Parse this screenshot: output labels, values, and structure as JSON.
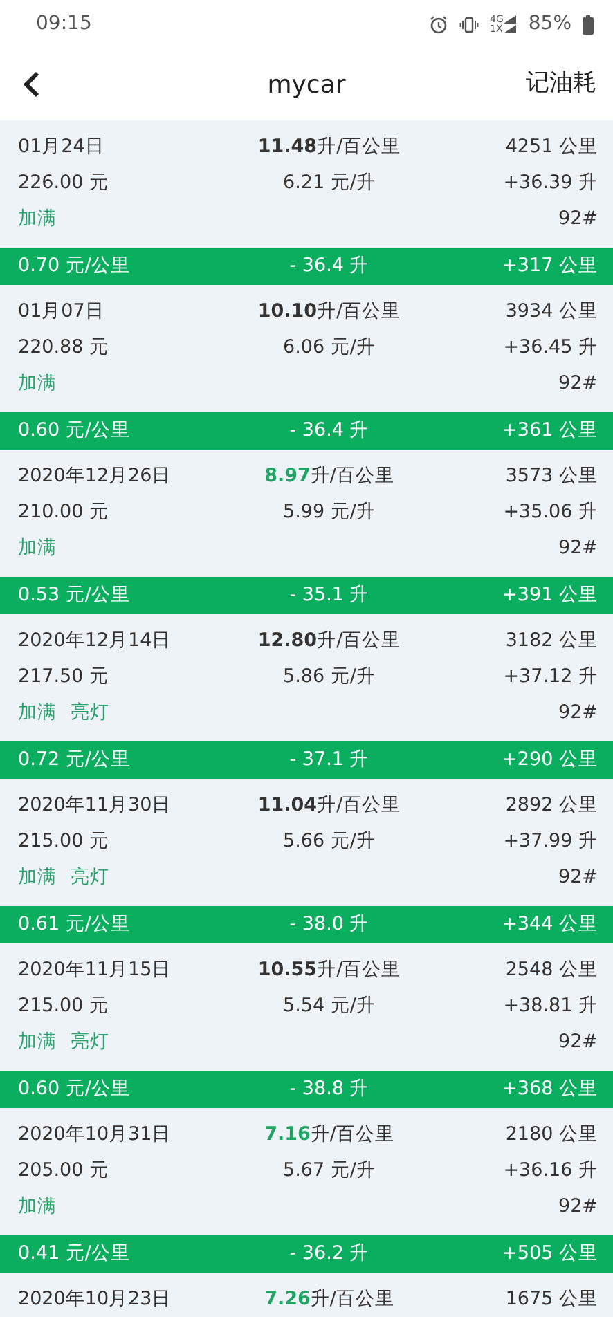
{
  "status_bar": {
    "time": "09:15",
    "network_top": "4G",
    "network_bottom": "1X",
    "battery": "85%"
  },
  "header": {
    "title": "mycar",
    "action": "记油耗"
  },
  "entries": [
    {
      "kind": "record",
      "date": "01月24日",
      "consumption": "11.48",
      "consumption_unit": "升/百公里",
      "efficient": false,
      "odometer": "4251 公里",
      "amount": "226.00 元",
      "price": "6.21 元/升",
      "volume": "+36.39 升",
      "tags": [
        "加满"
      ],
      "grade": "92#"
    },
    {
      "kind": "summary",
      "cost_per_km": "0.70 元/公里",
      "fuel_used": "- 36.4 升",
      "distance": "+317 公里"
    },
    {
      "kind": "record",
      "date": "01月07日",
      "consumption": "10.10",
      "consumption_unit": "升/百公里",
      "efficient": false,
      "odometer": "3934 公里",
      "amount": "220.88 元",
      "price": "6.06 元/升",
      "volume": "+36.45 升",
      "tags": [
        "加满"
      ],
      "grade": "92#"
    },
    {
      "kind": "summary",
      "cost_per_km": "0.60 元/公里",
      "fuel_used": "- 36.4 升",
      "distance": "+361 公里"
    },
    {
      "kind": "record",
      "date": "2020年12月26日",
      "consumption": "8.97",
      "consumption_unit": "升/百公里",
      "efficient": true,
      "odometer": "3573 公里",
      "amount": "210.00 元",
      "price": "5.99 元/升",
      "volume": "+35.06 升",
      "tags": [
        "加满"
      ],
      "grade": "92#"
    },
    {
      "kind": "summary",
      "cost_per_km": "0.53 元/公里",
      "fuel_used": "- 35.1 升",
      "distance": "+391 公里"
    },
    {
      "kind": "record",
      "date": "2020年12月14日",
      "consumption": "12.80",
      "consumption_unit": "升/百公里",
      "efficient": false,
      "odometer": "3182 公里",
      "amount": "217.50 元",
      "price": "5.86 元/升",
      "volume": "+37.12 升",
      "tags": [
        "加满",
        "亮灯"
      ],
      "grade": "92#"
    },
    {
      "kind": "summary",
      "cost_per_km": "0.72 元/公里",
      "fuel_used": "- 37.1 升",
      "distance": "+290 公里"
    },
    {
      "kind": "record",
      "date": "2020年11月30日",
      "consumption": "11.04",
      "consumption_unit": "升/百公里",
      "efficient": false,
      "odometer": "2892 公里",
      "amount": "215.00 元",
      "price": "5.66 元/升",
      "volume": "+37.99 升",
      "tags": [
        "加满",
        "亮灯"
      ],
      "grade": "92#"
    },
    {
      "kind": "summary",
      "cost_per_km": "0.61 元/公里",
      "fuel_used": "- 38.0 升",
      "distance": "+344 公里"
    },
    {
      "kind": "record",
      "date": "2020年11月15日",
      "consumption": "10.55",
      "consumption_unit": "升/百公里",
      "efficient": false,
      "odometer": "2548 公里",
      "amount": "215.00 元",
      "price": "5.54 元/升",
      "volume": "+38.81 升",
      "tags": [
        "加满",
        "亮灯"
      ],
      "grade": "92#"
    },
    {
      "kind": "summary",
      "cost_per_km": "0.60 元/公里",
      "fuel_used": "- 38.8 升",
      "distance": "+368 公里"
    },
    {
      "kind": "record",
      "date": "2020年10月31日",
      "consumption": "7.16",
      "consumption_unit": "升/百公里",
      "efficient": true,
      "odometer": "2180 公里",
      "amount": "205.00 元",
      "price": "5.67 元/升",
      "volume": "+36.16 升",
      "tags": [
        "加满"
      ],
      "grade": "92#"
    },
    {
      "kind": "summary",
      "cost_per_km": "0.41 元/公里",
      "fuel_used": "- 36.2 升",
      "distance": "+505 公里"
    },
    {
      "kind": "record",
      "date": "2020年10月23日",
      "consumption": "7.26",
      "consumption_unit": "升/百公里",
      "efficient": true,
      "odometer": "1675 公里"
    }
  ]
}
